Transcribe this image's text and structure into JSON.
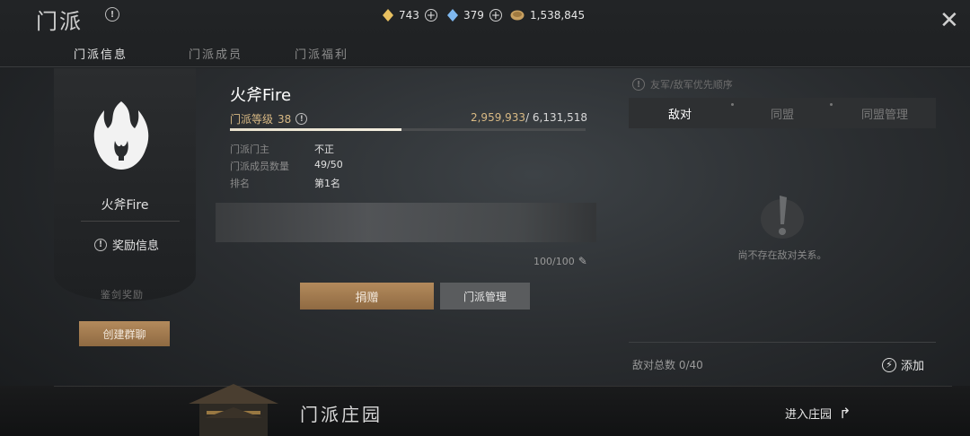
{
  "header": {
    "title": "门派",
    "currencies": [
      {
        "icon": "gold-crystal-icon",
        "value": "743",
        "color": "#e8c060"
      },
      {
        "icon": "blue-crystal-icon",
        "value": "379",
        "color": "#7fb8ef"
      },
      {
        "icon": "coin-icon",
        "value": "1,538,845",
        "color": "#c8a060"
      }
    ]
  },
  "tabs": [
    "门派信息",
    "门派成员",
    "门派福利"
  ],
  "banner": {
    "guild_name": "火斧Fire",
    "reward_info": "奖励信息",
    "seal_text": "鉴剑奖励",
    "create_chat": "创建群聊"
  },
  "guild": {
    "name": "火斧Fire",
    "level_label": "门派等级",
    "level": "38",
    "exp_current": "2,959,933",
    "exp_total": "/ 6,131,518",
    "exp_fraction": 0.4828,
    "rows": [
      {
        "label": "门派门主",
        "value": "不正"
      },
      {
        "label": "门派成员数量",
        "value": "49/50"
      },
      {
        "label": "排名",
        "value": "第1名"
      }
    ],
    "notice_count": "100/100",
    "donate": "捐赠",
    "manage": "门派管理"
  },
  "relations": {
    "priority_label": "友军/敌军优先顺序",
    "tabs": [
      "敌对",
      "同盟",
      "同盟管理"
    ],
    "empty_text": "尚不存在敌对关系。",
    "enemy_total": "敌对总数 0/40",
    "add": "添加"
  },
  "manor": {
    "title": "门派庄园",
    "enter": "进入庄园"
  }
}
